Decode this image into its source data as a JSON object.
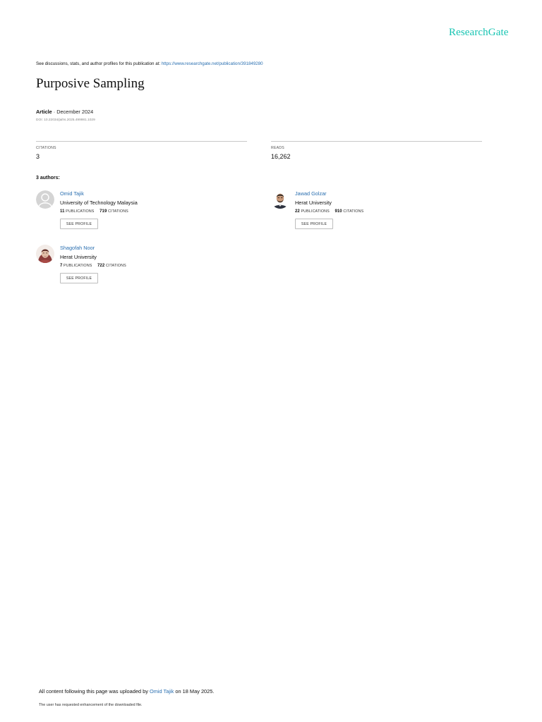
{
  "brand": {
    "logo_text": "ResearchGate",
    "accent": "#16c4b2"
  },
  "header": {
    "discussion_prefix": "See discussions, stats, and author profiles for this publication at: ",
    "publication_url": "https://www.researchgate.net/publication/391849280"
  },
  "publication": {
    "title": "Purposive Sampling",
    "type": "Article",
    "date": " · December 2024",
    "doi": "DOI: 10.22034/jaihs.2025.499981.1029"
  },
  "stats": {
    "citations_label": "CITATIONS",
    "citations_value": "3",
    "reads_label": "READS",
    "reads_value": "16,262"
  },
  "authors_heading": "3 authors:",
  "authors": [
    {
      "name": "Omid Tajik",
      "institution": "University of Technology Malaysia",
      "publications": "11",
      "publications_label": "PUBLICATIONS",
      "citations": "719",
      "citations_label": "CITATIONS",
      "button": "SEE PROFILE"
    },
    {
      "name": "Jawad Golzar",
      "institution": "Herat University",
      "publications": "22",
      "publications_label": "PUBLICATIONS",
      "citations": "910",
      "citations_label": "CITATIONS",
      "button": "SEE PROFILE"
    },
    {
      "name": "Shagofah Noor",
      "institution": "Herat University",
      "publications": "7",
      "publications_label": "PUBLICATIONS",
      "citations": "722",
      "citations_label": "CITATIONS",
      "button": "SEE PROFILE"
    }
  ],
  "footer": {
    "uploaded_prefix": "All content following this page was uploaded by ",
    "uploader": "Omid Tajik",
    "uploaded_suffix": " on 18 May 2025.",
    "enhancement_note": "The user has requested enhancement of the downloaded file."
  }
}
